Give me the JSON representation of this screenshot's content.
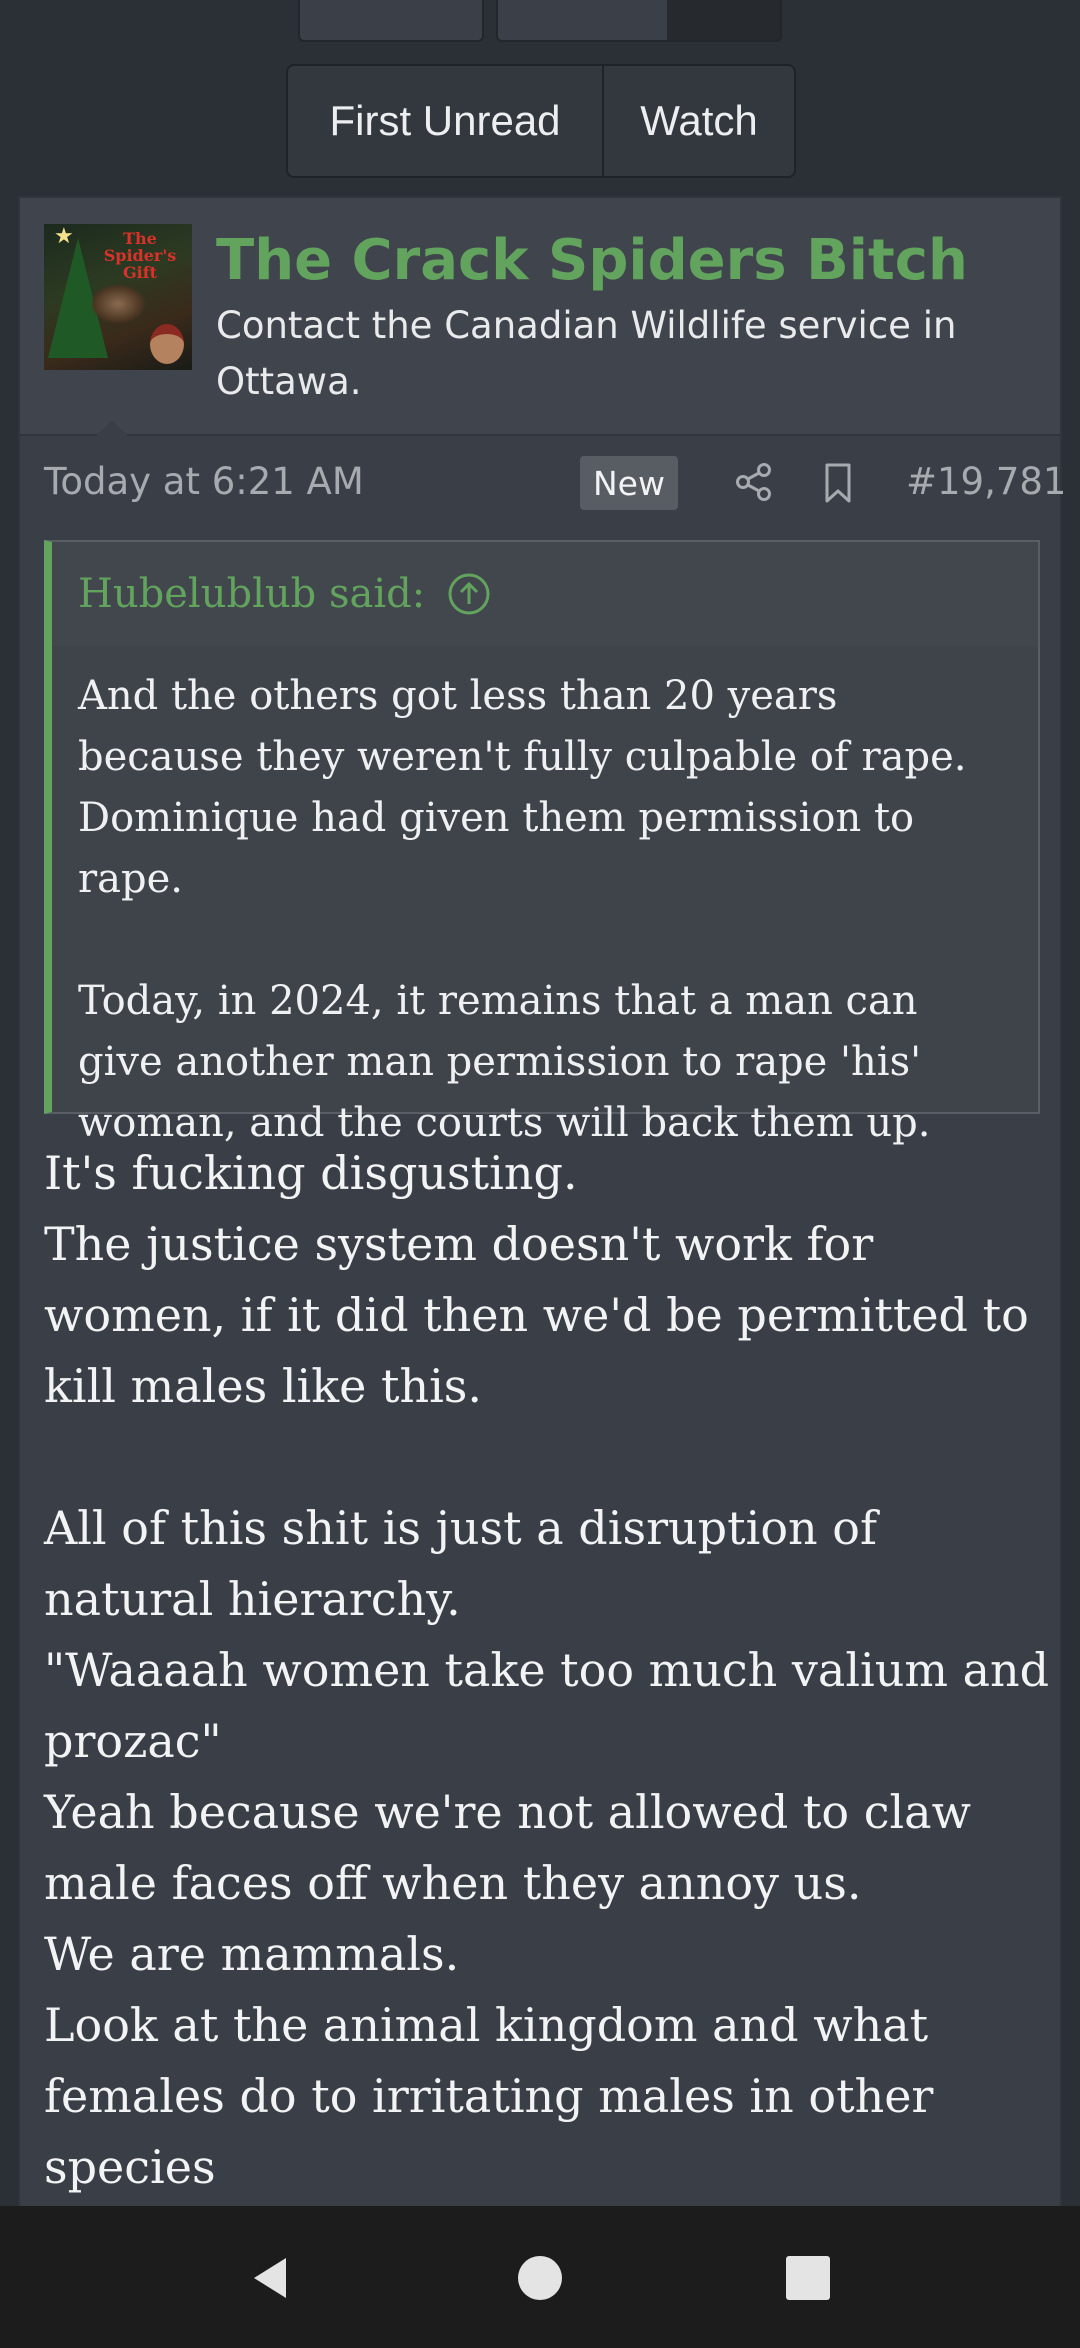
{
  "thread_nav": {
    "first_unread_label": "First Unread",
    "watch_label": "Watch"
  },
  "post": {
    "avatar_text": "The Spider's Gift",
    "username": "The Crack Spiders Bitch",
    "user_title": "Contact the Canadian Wildlife service in Ottawa.",
    "timestamp": "Today at 6:21 AM",
    "new_badge": "New",
    "post_number": "#19,781",
    "icons": [
      "share-icon",
      "bookmark-icon"
    ],
    "quote": {
      "author": "Hubelublub said:",
      "paragraph_1": "And the others got less than 20 years because they weren't fully culpable of rape. Dominique had given them permission to rape.",
      "paragraph_2": "Today, in 2024, it remains that a man can give another man permission to rape 'his' woman, and the courts will back them up."
    },
    "body_lines": [
      "It's fucking disgusting.",
      "The justice system doesn't work for women, if it did then we'd be permitted to kill males like this.",
      "",
      "All of this shit is just a disruption of natural hierarchy.",
      "\"Waaaah women take too much valium and prozac\"",
      "Yeah because we're not allowed to claw male faces off when they annoy us.",
      "We are mammals.",
      "Look at the animal kingdom and what females do to irritating males in other species"
    ]
  },
  "system_nav": {
    "icons": [
      "back-icon",
      "home-icon",
      "recents-icon"
    ]
  },
  "colors": {
    "accent_green": "#62a35d",
    "background": "#2b2f36",
    "post_bg": "#3a3e46"
  }
}
